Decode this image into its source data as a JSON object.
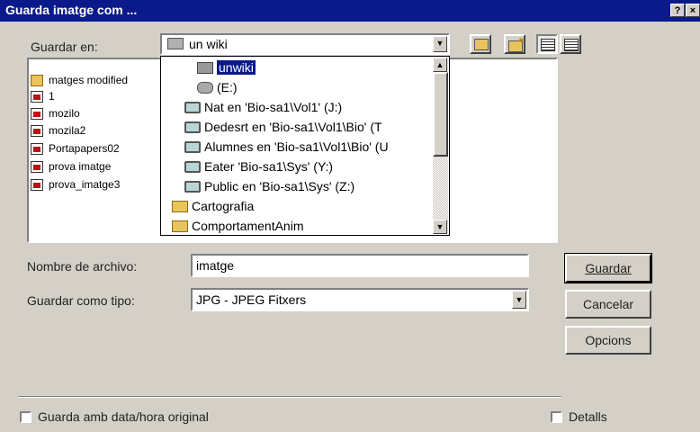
{
  "dialog": {
    "title": "Guarda imatge com ...",
    "help_label": "?",
    "close_label": "×"
  },
  "save_in": {
    "label": "Guardar en:",
    "value": "un wiki"
  },
  "files": [
    {
      "name": "matges modified",
      "icon": "folder-icon"
    },
    {
      "name": "1",
      "icon": "image-file-icon"
    },
    {
      "name": "mozilo",
      "icon": "image-file-icon"
    },
    {
      "name": "mozila2",
      "icon": "image-file-icon"
    },
    {
      "name": "Portapapers02",
      "icon": "image-file-icon"
    },
    {
      "name": "prova imatge",
      "icon": "image-file-icon"
    },
    {
      "name": "prova_imatge3",
      "icon": "image-file-icon"
    }
  ],
  "location_dropdown": [
    {
      "label": "unwiki",
      "icon": "folder-icon",
      "selected": true
    },
    {
      "label": "(E:)",
      "icon": "drive-icon"
    },
    {
      "label": "Nat en 'Bio-sa1\\Vol1' (J:)",
      "icon": "network-drive-icon"
    },
    {
      "label": "Dedesrt en 'Bio-sa1\\Vol1\\Bio' (T",
      "icon": "network-drive-icon"
    },
    {
      "label": "Alumnes en 'Bio-sa1\\Vol1\\Bio' (U",
      "icon": "network-drive-icon"
    },
    {
      "label": "Eater 'Bio-sa1\\Sys' (Y:)",
      "icon": "network-drive-icon"
    },
    {
      "label": "Public en 'Bio-sa1\\Sys' (Z:)",
      "icon": "network-drive-icon"
    },
    {
      "label": "Cartografia",
      "icon": "folder-icon"
    },
    {
      "label": "ComportamentAnim",
      "icon": "folder-icon"
    }
  ],
  "filename": {
    "label": "Nombre de archivo:",
    "value": "imatge"
  },
  "filetype": {
    "label": "Guardar como tipo:",
    "value": "JPG - JPEG Fitxers"
  },
  "buttons": {
    "save": "Guardar",
    "cancel": "Cancelar",
    "options": "Opcions"
  },
  "checkboxes": {
    "original_date": "Guarda amb data/hora original",
    "details": "Detalls"
  }
}
